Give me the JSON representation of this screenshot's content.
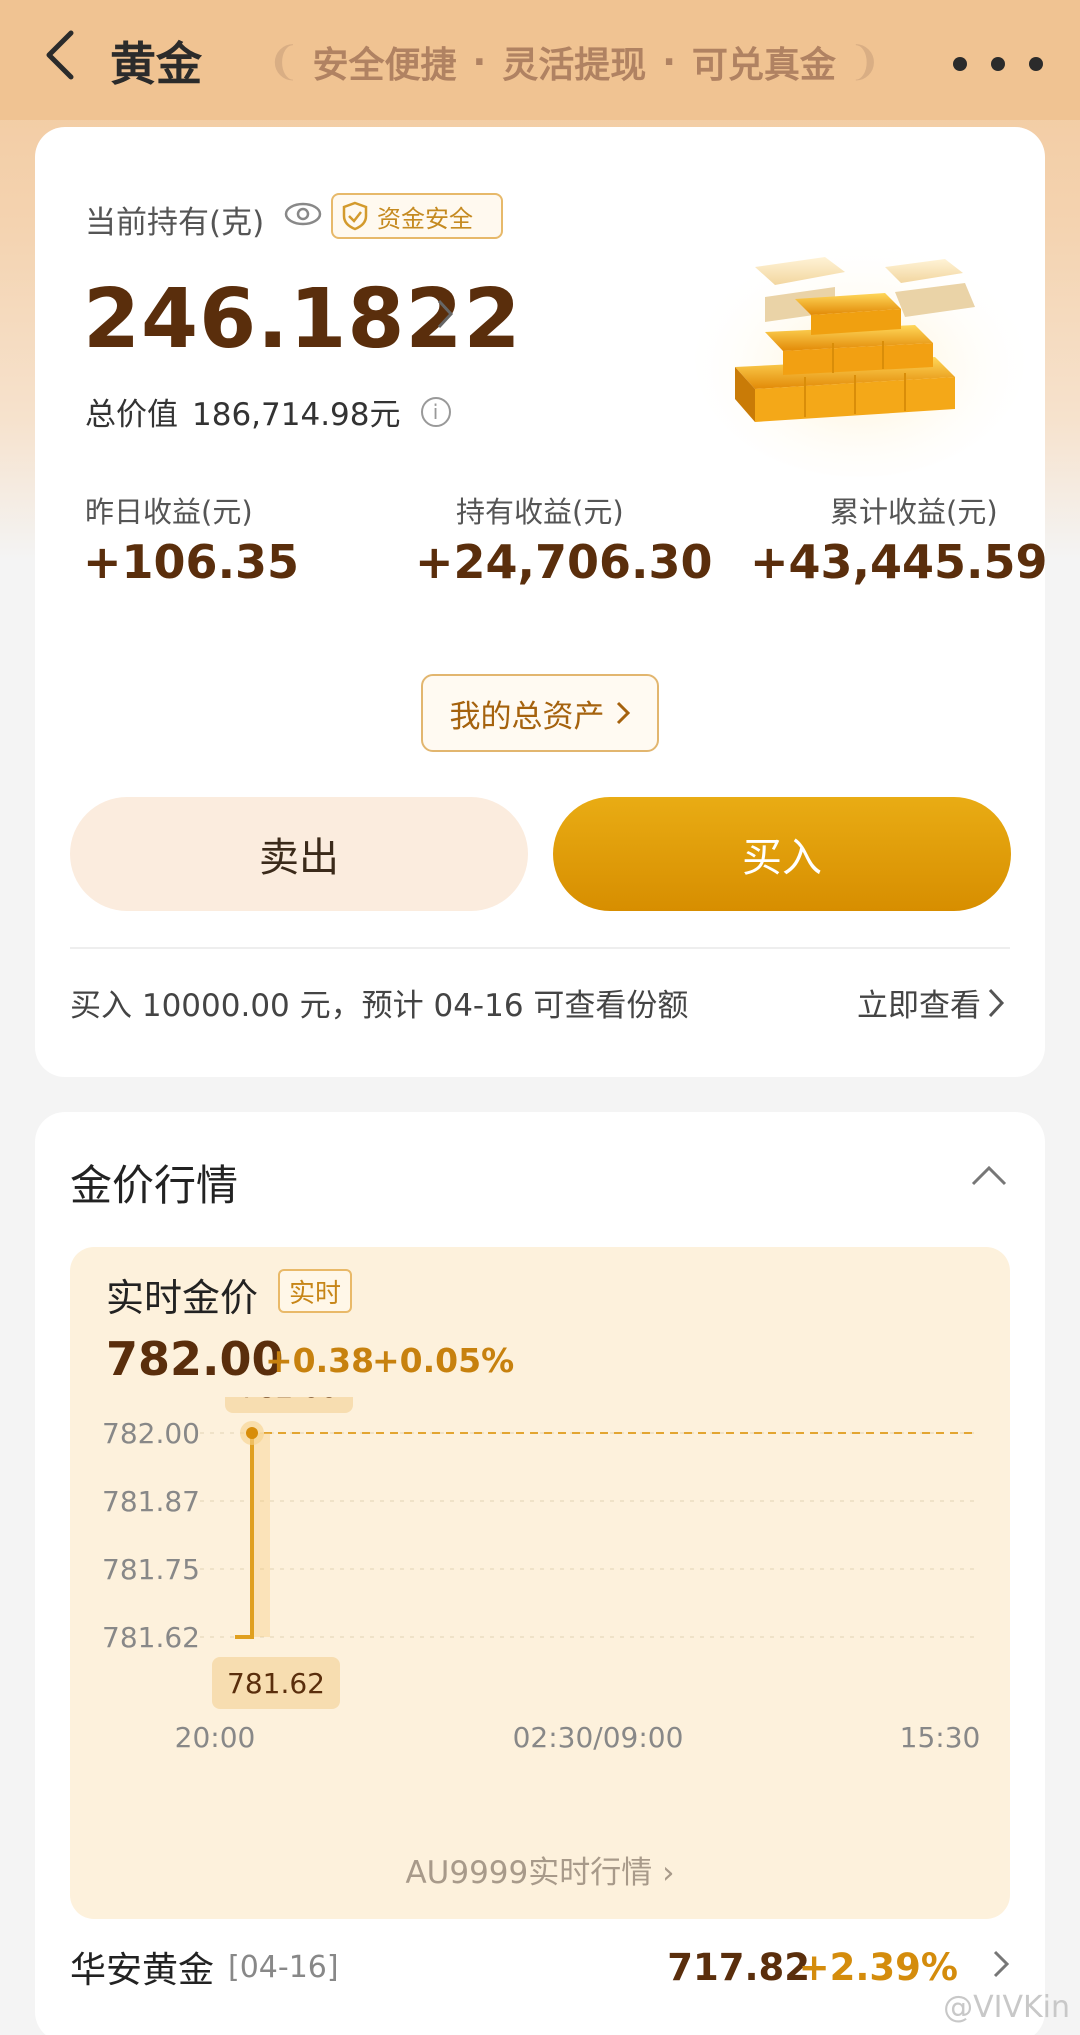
{
  "header": {
    "title": "黄金",
    "slogan": [
      "安全便捷",
      "灵活提现",
      "可兑真金"
    ]
  },
  "holding": {
    "label": "当前持有(克)",
    "safe_badge": "资金安全",
    "amount": "246.1822",
    "total_label": "总价值",
    "total_value": "186,714.98元"
  },
  "earnings": [
    {
      "label": "昨日收益(元)",
      "value": "+106.35"
    },
    {
      "label": "持有收益(元)",
      "value": "+24,706.30"
    },
    {
      "label": "累计收益(元)",
      "value": "+43,445.59"
    }
  ],
  "assets_button": "我的总资产",
  "actions": {
    "sell": "卖出",
    "buy": "买入"
  },
  "notice": {
    "text": "买入 10000.00 元，预计 04-16 可查看份额",
    "link": "立即查看"
  },
  "market": {
    "title": "金价行情",
    "panel_title": "实时金价",
    "live_badge": "实时",
    "price": "782.00",
    "change": "+0.38",
    "change_pct": "+0.05%",
    "tooltip_high": "782.00",
    "tooltip_low": "781.62",
    "link": "AU9999实时行情"
  },
  "chart_data": {
    "type": "line",
    "y_ticks": [
      "782.00",
      "781.87",
      "781.75",
      "781.62"
    ],
    "x_ticks": [
      "20:00",
      "02:30/09:00",
      "15:30"
    ],
    "ylim": [
      781.62,
      782.0
    ],
    "series": [
      {
        "values": [
          781.62,
          782.0
        ]
      }
    ],
    "reference_line": 782.0
  },
  "product": {
    "name": "华安黄金",
    "date": "[04-16]",
    "price": "717.82",
    "pct": "+2.39%"
  },
  "watermark": "@VIVKin",
  "colors": {
    "accent": "#d78e00",
    "brown": "#5a2e0c",
    "header": "#f0c392"
  }
}
